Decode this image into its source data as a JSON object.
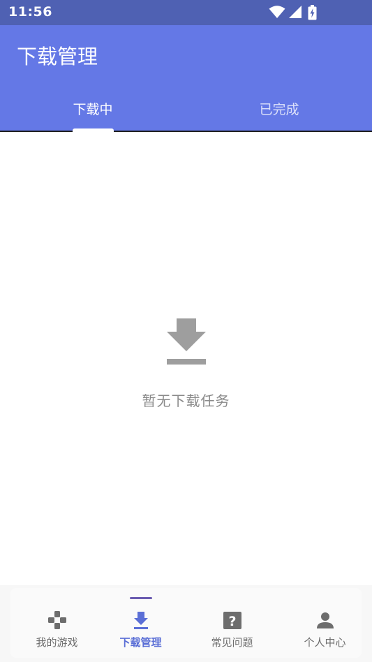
{
  "status_bar": {
    "time": "11:56",
    "icons": [
      "wifi-icon",
      "cellular-signal-icon",
      "battery-charging-icon"
    ]
  },
  "app_bar": {
    "title": "下载管理",
    "background_color": "#6478e6"
  },
  "tabs": [
    {
      "label": "下载中",
      "active": true
    },
    {
      "label": "已完成",
      "active": false
    }
  ],
  "empty_state": {
    "icon": "download-icon",
    "message": "暂无下载任务"
  },
  "bottom_nav": {
    "accent_color": "#5b6fd6",
    "items": [
      {
        "label": "我的游戏",
        "icon": "gamepad-icon",
        "active": false
      },
      {
        "label": "下载管理",
        "icon": "download-icon",
        "active": true
      },
      {
        "label": "常见问题",
        "icon": "question-icon",
        "active": false
      },
      {
        "label": "个人中心",
        "icon": "person-icon",
        "active": false
      }
    ]
  }
}
